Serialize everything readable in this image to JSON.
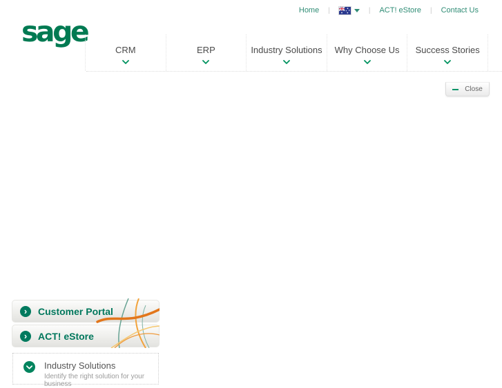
{
  "topbar": {
    "home_label": "Home",
    "separator": "|",
    "language_flag": "australia-flag-icon",
    "estore_label": "ACT! eStore",
    "contact_label": "Contact Us"
  },
  "brand": {
    "logo_text": "sage"
  },
  "nav": {
    "items": [
      {
        "label": "CRM"
      },
      {
        "label": "ERP"
      },
      {
        "label": "Industry Solutions"
      },
      {
        "label": "Why Choose Us"
      },
      {
        "label": "Success Stories"
      }
    ]
  },
  "panel": {
    "close_label": "Close"
  },
  "promo": {
    "items": [
      {
        "label": "Customer Portal"
      },
      {
        "label": "ACT! eStore"
      }
    ],
    "arrow_glyph": "›"
  },
  "industry_box": {
    "title": "Industry Solutions",
    "subtitle": "Identify the right solution for your business"
  },
  "colors": {
    "brand_green": "#007a52",
    "link_teal": "#2f8c75",
    "chevron_green": "#00925f",
    "circle_green": "#007a5e",
    "curve_orange": "#e2761b",
    "curve_amber": "#f2a33c",
    "curve_teal": "#67a393"
  }
}
